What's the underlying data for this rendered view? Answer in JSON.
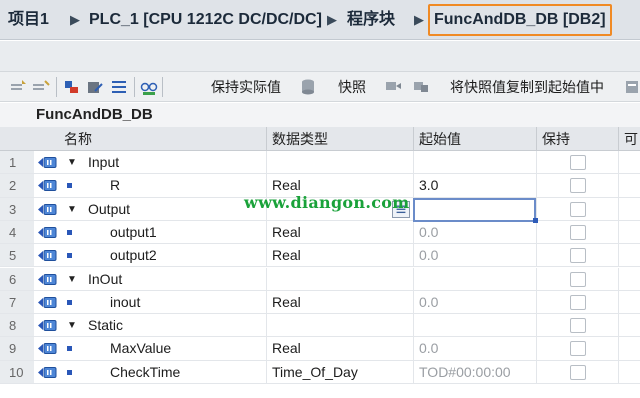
{
  "breadcrumb": {
    "items": [
      "项目1",
      "PLC_1 [CPU 1212C DC/DC/DC]",
      "程序块",
      "FuncAndDB_DB [DB2]"
    ],
    "separator": "▶"
  },
  "toolbar": {
    "keep_actual_values": "保持实际值",
    "snapshot": "快照",
    "copy_snapshot_to_start": "将快照值复制到起始值中"
  },
  "block": {
    "name": "FuncAndDB_DB"
  },
  "table": {
    "columns": [
      "名称",
      "数据类型",
      "起始值",
      "保持",
      "可"
    ],
    "rows": [
      {
        "num": "1",
        "kind": "section",
        "name": "Input",
        "type": "",
        "start": "",
        "start_gray": false
      },
      {
        "num": "2",
        "kind": "item",
        "name": "R",
        "type": "Real",
        "start": "3.0",
        "start_gray": false
      },
      {
        "num": "3",
        "kind": "section",
        "name": "Output",
        "type": "",
        "start": "",
        "start_gray": false
      },
      {
        "num": "4",
        "kind": "item",
        "name": "output1",
        "type": "Real",
        "start": "0.0",
        "start_gray": true
      },
      {
        "num": "5",
        "kind": "item",
        "name": "output2",
        "type": "Real",
        "start": "0.0",
        "start_gray": true
      },
      {
        "num": "6",
        "kind": "section",
        "name": "InOut",
        "type": "",
        "start": "",
        "start_gray": false
      },
      {
        "num": "7",
        "kind": "item",
        "name": "inout",
        "type": "Real",
        "start": "0.0",
        "start_gray": true
      },
      {
        "num": "8",
        "kind": "section",
        "name": "Static",
        "type": "",
        "start": "",
        "start_gray": false
      },
      {
        "num": "9",
        "kind": "item",
        "name": "MaxValue",
        "type": "Real",
        "start": "0.0",
        "start_gray": true
      },
      {
        "num": "10",
        "kind": "item",
        "name": "CheckTime",
        "type": "Time_Of_Day",
        "start": "TOD#00:00:00",
        "start_gray": true
      }
    ]
  },
  "watermark": "www.diangon.com",
  "colors": {
    "highlight_border": "#f08a24",
    "selection": "#6b8cc9",
    "watermark": "#1aa23a",
    "tag_blue": "#2a57b8"
  }
}
